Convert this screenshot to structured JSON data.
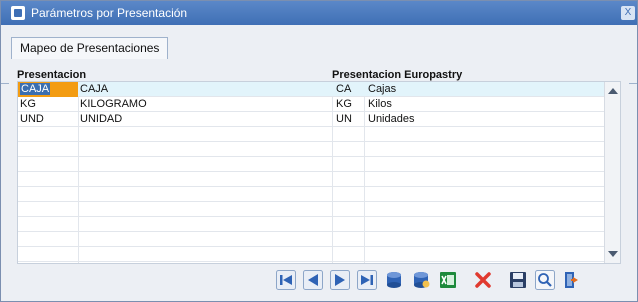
{
  "window": {
    "title": "Parámetros por Presentación",
    "close_label": "X"
  },
  "tabs": [
    {
      "label": "Mapeo de Presentaciones"
    }
  ],
  "grid": {
    "headers": {
      "presentacion": "Presentacion",
      "europastry": "Presentacion Europastry"
    },
    "rows": [
      {
        "code": "CAJA",
        "desc": "CAJA",
        "ecode": "CA",
        "edesc": "Cajas"
      },
      {
        "code": "KG",
        "desc": "KILOGRAMO",
        "ecode": "KG",
        "edesc": "Kilos"
      },
      {
        "code": "UND",
        "desc": "UNIDAD",
        "ecode": "UN",
        "edesc": "Unidades"
      }
    ]
  },
  "toolbar": {
    "icons": [
      "first-icon",
      "prev-icon",
      "next-icon",
      "last-icon",
      "database-icon",
      "database-save-icon",
      "excel-icon",
      "delete-icon",
      "save-icon",
      "search-icon",
      "exit-icon"
    ],
    "colors": {
      "blue": "#2f63b5",
      "red": "#e03a2f",
      "green": "#1e8a3c"
    }
  }
}
